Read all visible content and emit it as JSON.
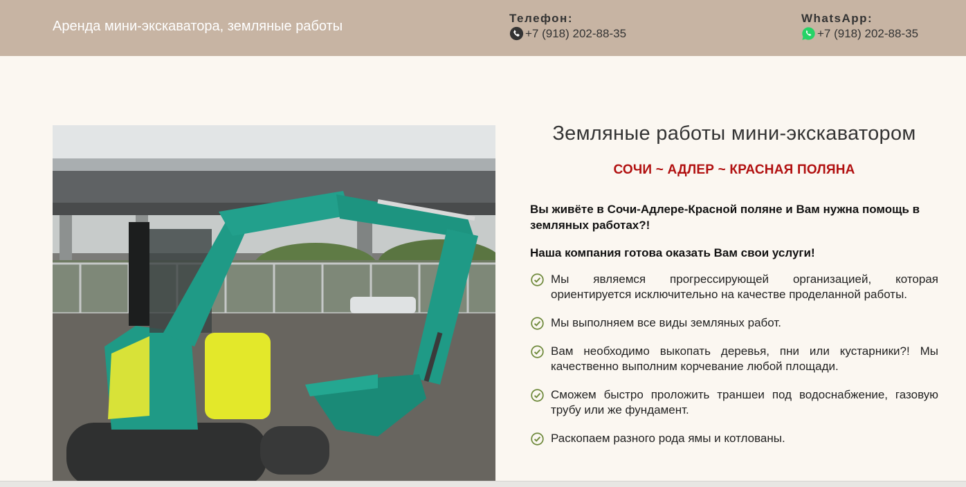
{
  "header": {
    "site_title": "Аренда мини-экскаватора, земляные работы",
    "phone": {
      "label": "Телефон:",
      "number": "+7 (918) 202-88-35",
      "icon": "phone-icon"
    },
    "whatsapp": {
      "label": "WhatsApp:",
      "number": "+7 (918) 202-88-35",
      "icon": "whatsapp-icon"
    }
  },
  "main": {
    "title": "Земляные работы мини-экскаватором",
    "subtitle": "СОЧИ ~ АДЛЕР ~ КРАСНАЯ ПОЛЯНА",
    "intro": "Вы живёте в Сочи-Адлере-Красной поляне и Вам нужна помощь в земляных работах?!",
    "intro2": "Наша компания готова оказать Вам свои услуги!",
    "features": [
      "Мы являемся прогрессирующей организацией, которая ориентируется исключительно на качестве проделанной работы.",
      "Мы выполняем все виды земляных работ.",
      "Вам необходимо выкопать деревья, пни или кустарники?! Мы качественно выполним корчевание любой площади.",
      "Сможем быстро проложить траншеи под водоснабжение, газовую трубу или же фундамент.",
      "Раскопаем разного рода ямы и котлованы."
    ]
  },
  "colors": {
    "header_bg": "#c7b4a3",
    "page_bg": "#fbf7f1",
    "accent_red": "#b11010",
    "check_color": "#6f8a3c",
    "whatsapp_green": "#25d366",
    "excavator_teal": "#1f9a86",
    "excavator_yellow": "#e3e82a"
  }
}
